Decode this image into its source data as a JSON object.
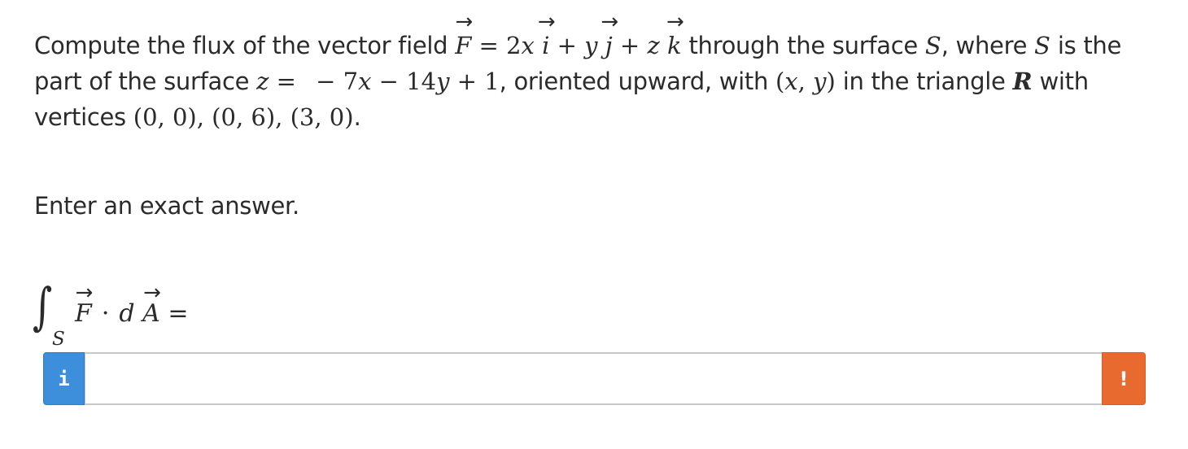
{
  "question": {
    "t1": "Compute the flux of the vector field ",
    "F": "F",
    "arrow": "→",
    "eq1": " = 2",
    "x1": "x",
    "i": "i",
    "plus1": " + ",
    "y1": "y",
    "j": "j",
    "plus2": " + ",
    "z1": "z",
    "k": "k",
    "t2": " through the surface ",
    "S1": "S",
    "t3": ", where ",
    "S2": "S",
    "t4": " is the part of the surface ",
    "z2": "z",
    "eq2": " =   − 7",
    "x2": "x",
    "minus": " − 14",
    "y2": "y",
    "plus3": " + 1",
    "t5": ", oriented upward, with ",
    "paren_open": "(",
    "x3": "x",
    "comma": ", ",
    "y3": "y",
    "paren_close": ")",
    "t6": " in the triangle ",
    "R": "R",
    "t7": " with vertices ",
    "vertices": "(0, 0), (0, 6), (3, 0)",
    "t8": "."
  },
  "instruction": "Enter an exact answer.",
  "integral": {
    "sign": "∫",
    "subscript": "S",
    "F": "F",
    "dot": "·",
    "d": "d",
    "A": "A",
    "arrow": "→",
    "equals": " ="
  },
  "answer": {
    "value": "",
    "info_icon_glyph": "i",
    "warning_icon_glyph": "!",
    "info_color": "#3d8fdb",
    "warning_color": "#e86a2e"
  }
}
